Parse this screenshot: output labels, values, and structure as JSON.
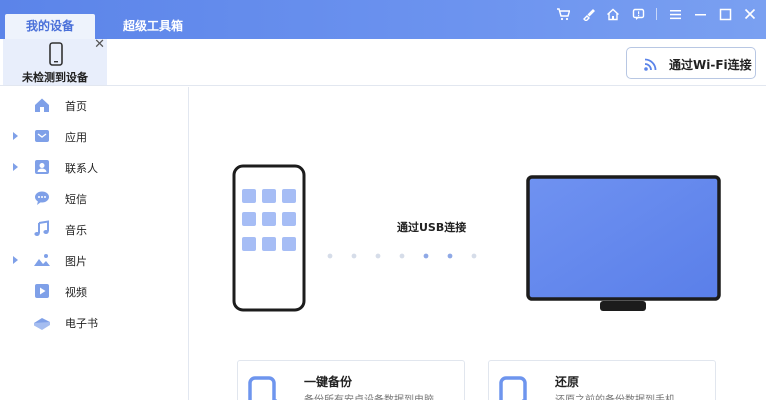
{
  "tabs": [
    {
      "label": "我的设备",
      "active": true
    },
    {
      "label": "超级工具箱",
      "active": false
    }
  ],
  "window_icons": [
    "cart-icon",
    "brush-icon",
    "home-icon",
    "feedback-icon",
    "menu-icon",
    "minimize-icon",
    "maximize-icon",
    "close-icon"
  ],
  "device": {
    "status_label": "未检测到设备",
    "icon": "phone-icon"
  },
  "wifi_button": {
    "label": "通过Wi-Fi连接",
    "icon": "wifi-icon"
  },
  "sidebar": {
    "items": [
      {
        "label": "首页",
        "icon": "home-icon",
        "expandable": false
      },
      {
        "label": "应用",
        "icon": "app-icon",
        "expandable": true
      },
      {
        "label": "联系人",
        "icon": "contact-icon",
        "expandable": true
      },
      {
        "label": "短信",
        "icon": "message-icon",
        "expandable": false
      },
      {
        "label": "音乐",
        "icon": "music-icon",
        "expandable": false
      },
      {
        "label": "图片",
        "icon": "picture-icon",
        "expandable": true
      },
      {
        "label": "视频",
        "icon": "video-icon",
        "expandable": false
      },
      {
        "label": "电子书",
        "icon": "ebook-icon",
        "expandable": false
      }
    ]
  },
  "main": {
    "connect_label": "通过USB连接",
    "cards": [
      {
        "title": "一键备份",
        "desc": "备份所有安卓设备数据到电脑",
        "icon": "backup-icon"
      },
      {
        "title": "还原",
        "desc": "还原之前的备份数据到手机",
        "icon": "restore-icon"
      }
    ]
  },
  "colors": {
    "accent": "#5b84e9",
    "icon_blue": "#7fa0e8",
    "monitor_screen": "#6c8ff0"
  }
}
